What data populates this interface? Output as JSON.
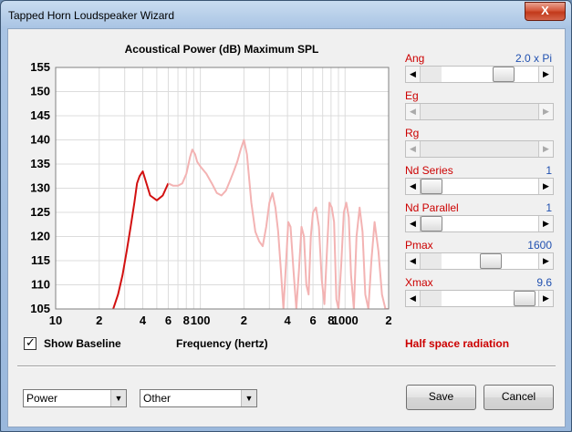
{
  "window": {
    "title": "Tapped Horn Loudspeaker Wizard",
    "close_glyph": "X"
  },
  "plot": {
    "title": "Acoustical Power (dB)   Maximum SPL",
    "x_axis_label": "Frequency (hertz)"
  },
  "chart_data": {
    "type": "line",
    "title": "Acoustical Power (dB)   Maximum SPL",
    "xlabel": "Frequency (hertz)",
    "ylabel": "",
    "x_scale": "log",
    "xlim": [
      10,
      2000
    ],
    "ylim": [
      105,
      155
    ],
    "y_ticks": [
      155,
      150,
      145,
      140,
      135,
      130,
      125,
      120,
      115,
      110,
      105
    ],
    "x_ticks": [
      {
        "value": 10,
        "label": "10"
      },
      {
        "value": 20,
        "label": "2"
      },
      {
        "value": 40,
        "label": "4"
      },
      {
        "value": 60,
        "label": "6"
      },
      {
        "value": 80,
        "label": "8"
      },
      {
        "value": 100,
        "label": "100"
      },
      {
        "value": 200,
        "label": "2"
      },
      {
        "value": 400,
        "label": "4"
      },
      {
        "value": 600,
        "label": "6"
      },
      {
        "value": 800,
        "label": "8"
      },
      {
        "value": 1000,
        "label": "1000"
      },
      {
        "value": 2000,
        "label": "2"
      }
    ],
    "grid": true,
    "series": [
      {
        "color": "#d21010",
        "x": [
          25,
          27,
          29,
          31,
          33,
          35,
          36.5,
          38,
          40,
          45,
          50,
          55,
          60
        ],
        "y": [
          105,
          108,
          112,
          117,
          122,
          127,
          131,
          132.5,
          133.5,
          128.5,
          127.5,
          128.5,
          131
        ]
      },
      {
        "color": "#f3b3b3",
        "x": [
          60,
          65,
          70,
          75,
          80,
          85,
          88,
          92,
          95,
          100,
          110,
          120,
          130,
          140,
          150,
          160,
          170,
          180,
          190,
          200,
          210,
          225,
          240,
          255,
          270,
          285,
          300,
          315,
          330,
          345,
          360,
          375,
          390,
          405,
          420,
          440,
          460,
          480,
          500,
          520,
          540,
          560,
          580,
          600,
          630,
          660,
          690,
          720,
          750,
          780,
          810,
          840,
          870,
          900,
          940,
          980,
          1020,
          1060,
          1100,
          1150,
          1200,
          1260,
          1320,
          1380,
          1450,
          1520,
          1600,
          1700,
          1800,
          1900,
          2000
        ],
        "y": [
          131,
          130.5,
          130.5,
          131,
          133,
          136.5,
          138,
          137,
          135.5,
          134.5,
          133,
          131,
          129,
          128.5,
          129.5,
          131.5,
          133.5,
          135.5,
          138,
          140,
          137,
          127,
          121,
          119,
          118,
          122,
          127,
          129,
          126,
          121,
          113,
          105,
          114,
          123,
          122,
          113,
          105,
          113,
          122,
          120,
          110,
          108,
          120,
          125,
          126,
          122,
          111,
          106,
          117,
          127,
          126,
          123,
          107,
          105,
          114,
          125,
          127,
          124,
          112,
          105,
          120,
          126,
          121,
          108,
          105,
          115,
          123,
          117,
          108,
          105,
          105
        ]
      }
    ]
  },
  "baseline": {
    "label": "Show Baseline",
    "checked": true,
    "check_glyph": "✓"
  },
  "radiation_label": "Half space radiation",
  "params": [
    {
      "label": "Ang",
      "value": "2.0 x Pi",
      "position": 0.75,
      "enabled": true
    },
    {
      "label": "Eg",
      "value": "",
      "position": null,
      "enabled": false
    },
    {
      "label": "Rg",
      "value": "",
      "position": null,
      "enabled": false
    },
    {
      "label": "Nd  Series",
      "value": "1",
      "position": 0.0,
      "enabled": true
    },
    {
      "label": "Nd  Parallel",
      "value": "1",
      "position": 0.0,
      "enabled": true
    },
    {
      "label": "Pmax",
      "value": "1600",
      "position": 0.62,
      "enabled": true
    },
    {
      "label": "Xmax",
      "value": "9.6",
      "position": 0.97,
      "enabled": true
    }
  ],
  "selects": {
    "left_value": "Power",
    "right_value": "Other"
  },
  "buttons": {
    "save": "Save",
    "cancel": "Cancel"
  },
  "glyphs": {
    "arrow_left": "◀",
    "arrow_right": "▶",
    "arrow_down": "▼"
  },
  "colors": {
    "accent_red": "#cc0000",
    "value_blue": "#2050b0"
  }
}
